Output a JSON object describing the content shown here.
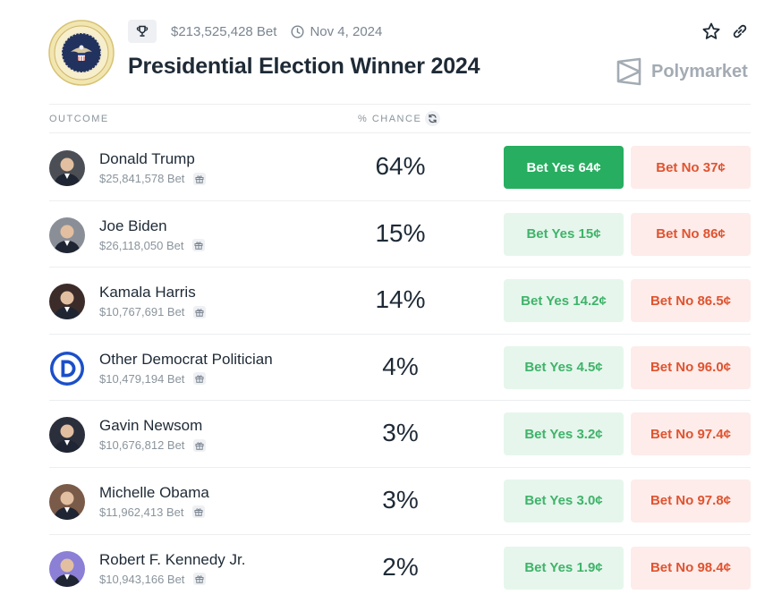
{
  "market": {
    "volume": "$213,525,428 Bet",
    "end_date": "Nov 4, 2024",
    "title": "Presidential Election Winner 2024",
    "brand": "Polymarket"
  },
  "columns": {
    "outcome": "OUTCOME",
    "chance": "% CHANCE"
  },
  "outcomes": [
    {
      "name": "Donald Trump",
      "volume": "$25,841,578 Bet",
      "chance": "64%",
      "yes": "Bet Yes 64¢",
      "no": "Bet No 37¢",
      "avatar_bg": "#4b4f55",
      "yes_active": true
    },
    {
      "name": "Joe Biden",
      "volume": "$26,118,050 Bet",
      "chance": "15%",
      "yes": "Bet Yes 15¢",
      "no": "Bet No 86¢",
      "avatar_bg": "#8a8f97"
    },
    {
      "name": "Kamala Harris",
      "volume": "$10,767,691 Bet",
      "chance": "14%",
      "yes": "Bet Yes 14.2¢",
      "no": "Bet No 86.5¢",
      "avatar_bg": "#3b2c2a"
    },
    {
      "name": "Other Democrat Politician",
      "volume": "$10,479,194 Bet",
      "chance": "4%",
      "yes": "Bet Yes 4.5¢",
      "no": "Bet No 96.0¢",
      "avatar_bg": "#ffffff"
    },
    {
      "name": "Gavin Newsom",
      "volume": "$10,676,812 Bet",
      "chance": "3%",
      "yes": "Bet Yes 3.2¢",
      "no": "Bet No 97.4¢",
      "avatar_bg": "#2a2f3b"
    },
    {
      "name": "Michelle Obama",
      "volume": "$11,962,413 Bet",
      "chance": "3%",
      "yes": "Bet Yes 3.0¢",
      "no": "Bet No 97.8¢",
      "avatar_bg": "#7a5a48"
    },
    {
      "name": "Robert F. Kennedy Jr.",
      "volume": "$10,943,166 Bet",
      "chance": "2%",
      "yes": "Bet Yes 1.9¢",
      "no": "Bet No 98.4¢",
      "avatar_bg": "#8b7fd6"
    }
  ],
  "colors": {
    "yes_active": "#27ae60",
    "yes_bg": "#e6f6ec",
    "yes_text": "#3fb36a",
    "no_bg": "#fdecea",
    "no_text": "#e0532f"
  },
  "icons": {
    "trophy": "trophy-icon",
    "clock": "clock-icon",
    "star": "star-icon",
    "link": "link-icon",
    "refresh": "refresh-icon",
    "gift": "gift-icon",
    "seal": "presidential-seal-icon",
    "brand": "polymarket-logo-icon",
    "democrat": "democrat-d-logo-icon"
  }
}
